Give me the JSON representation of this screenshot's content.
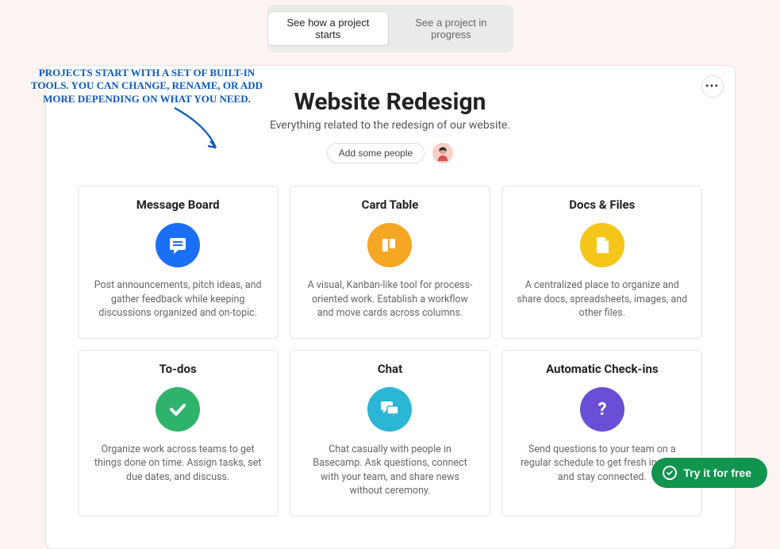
{
  "tabs": {
    "active": "See how a project starts",
    "inactive": "See a project in progress"
  },
  "project": {
    "title": "Website Redesign",
    "subtitle": "Everything related to the redesign of our website.",
    "add_people_label": "Add some people"
  },
  "annotation": {
    "text": "Projects start with a set of built-in tools. You can change, rename, or add more depending on what you need."
  },
  "tools": [
    {
      "title": "Message Board",
      "desc": "Post announcements, pitch ideas, and gather feedback while keeping discussions organized and on-topic.",
      "color": "#1b6ff5",
      "icon": "message"
    },
    {
      "title": "Card Table",
      "desc": "A visual, Kanban-like tool for process-oriented work. Establish a workflow and move cards across columns.",
      "color": "#f5a623",
      "icon": "cards"
    },
    {
      "title": "Docs & Files",
      "desc": "A centralized place to organize and share docs, spreadsheets, images, and other files.",
      "color": "#f5c518",
      "icon": "doc"
    },
    {
      "title": "To-dos",
      "desc": "Organize work across teams to get things done on time. Assign tasks, set due dates, and discuss.",
      "color": "#2fb36a",
      "icon": "check"
    },
    {
      "title": "Chat",
      "desc": "Chat casually with people in Basecamp. Ask questions, connect with your team, and share news without ceremony.",
      "color": "#2bb6d6",
      "icon": "chat"
    },
    {
      "title": "Automatic Check-ins",
      "desc": "Send questions to your team on a regular schedule to get fresh insights and stay connected.",
      "color": "#6a4fd6",
      "icon": "question"
    }
  ],
  "cta": {
    "label": "Try it for free"
  }
}
